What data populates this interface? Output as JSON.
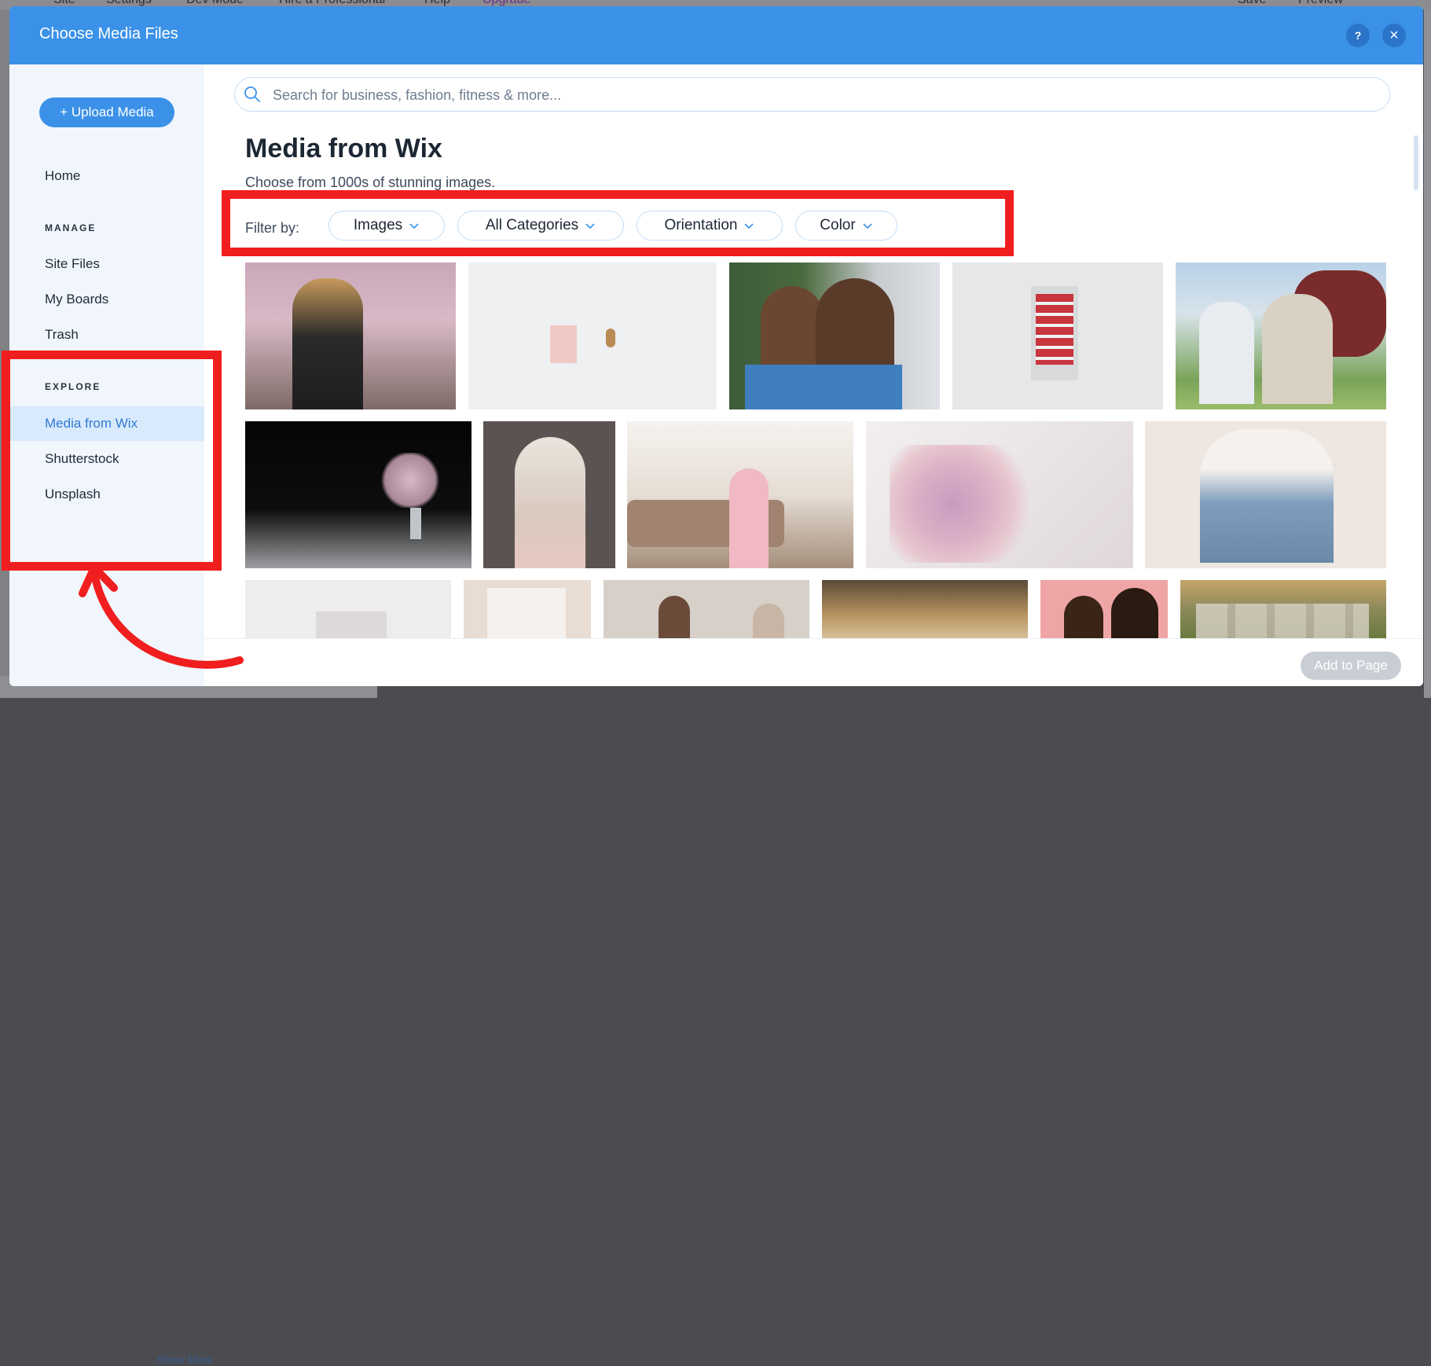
{
  "background": {
    "topbar_items": [
      "Site",
      "Settings",
      "Dev Mode",
      "Hire a Professional",
      "Help",
      "Upgrade",
      "Save",
      "Preview"
    ],
    "show_more_label": "Show More"
  },
  "modal": {
    "title": "Choose Media Files",
    "help_label": "?",
    "close_label": "×"
  },
  "sidebar": {
    "upload_label": "+ Upload Media",
    "home_label": "Home",
    "manage_label": "MANAGE",
    "manage_items": [
      "Site Files",
      "My Boards",
      "Trash"
    ],
    "explore_label": "EXPLORE",
    "explore_items": [
      "Media from Wix",
      "Shutterstock",
      "Unsplash"
    ],
    "active_item": "Media from Wix"
  },
  "search": {
    "placeholder": "Search for business, fashion, fitness & more..."
  },
  "main": {
    "title": "Media from Wix",
    "subtitle": "Choose from 1000s of stunning images.",
    "filter_label": "Filter by:",
    "filters": [
      "Images",
      "All Categories",
      "Orientation",
      "Color"
    ]
  },
  "footer": {
    "add_label": "Add to Page"
  },
  "icons": {
    "search": "search-icon",
    "chevron": "chevron-down-icon",
    "help": "help-icon",
    "close": "close-icon"
  },
  "colors": {
    "header": "#3b91e8",
    "accent": "#3b91e8",
    "sidebar_bg": "#f1f6fc",
    "active_nav": "#d9eafc",
    "annotation": "#f01e1e",
    "disabled_button": "#c9ced5"
  }
}
